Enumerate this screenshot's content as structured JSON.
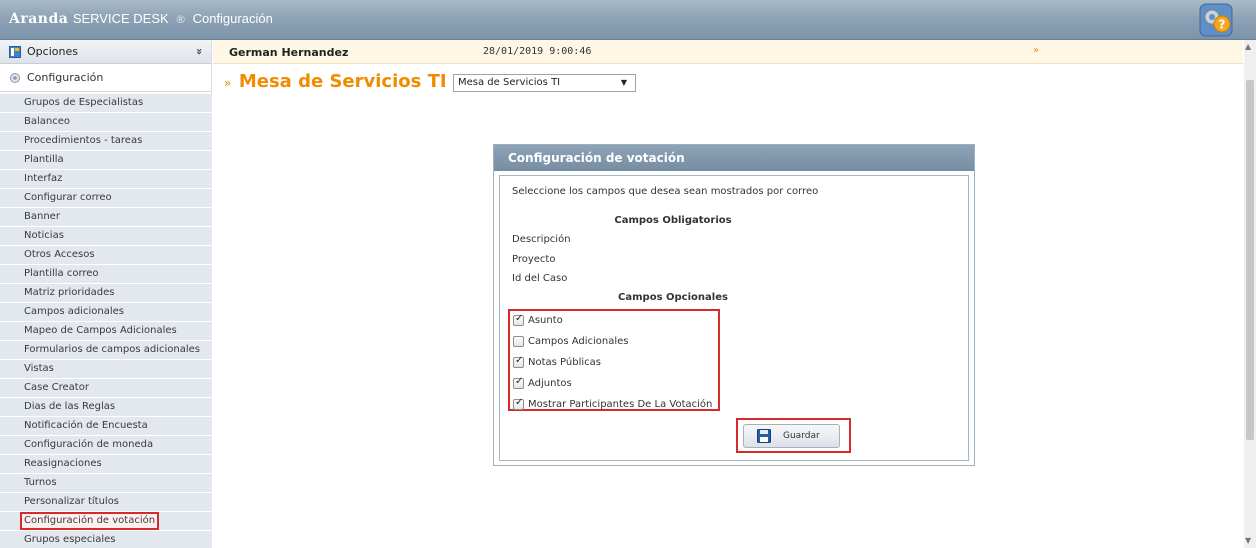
{
  "header": {
    "brand_bold": "Aranda",
    "brand_product": "SERVICE DESK",
    "brand_reg": "®",
    "brand_section": "Configuración",
    "help_icon": "help-gear-icon"
  },
  "sidebar": {
    "options_label": "Opciones",
    "options_chevron": "»",
    "section_label": "Configuración",
    "items": [
      {
        "label": "Grupos de Especialistas"
      },
      {
        "label": "Balanceo"
      },
      {
        "label": "Procedimientos - tareas"
      },
      {
        "label": "Plantilla"
      },
      {
        "label": "Interfaz"
      },
      {
        "label": "Configurar correo"
      },
      {
        "label": "Banner"
      },
      {
        "label": "Noticias"
      },
      {
        "label": "Otros Accesos"
      },
      {
        "label": "Plantilla correo"
      },
      {
        "label": "Matriz prioridades"
      },
      {
        "label": "Campos adicionales"
      },
      {
        "label": "Mapeo de Campos Adicionales"
      },
      {
        "label": "Formularios de campos adicionales"
      },
      {
        "label": "Vistas"
      },
      {
        "label": "Case Creator"
      },
      {
        "label": "Dias de las Reglas"
      },
      {
        "label": "Notificación de Encuesta"
      },
      {
        "label": "Configuración de moneda"
      },
      {
        "label": "Reasignaciones"
      },
      {
        "label": "Turnos"
      },
      {
        "label": "Personalizar títulos"
      },
      {
        "label": "Configuración de votación"
      },
      {
        "label": "Grupos especiales"
      }
    ]
  },
  "infobar": {
    "user": "German Hernandez",
    "datetime": "28/01/2019 9:00:46",
    "arrow": "»"
  },
  "main": {
    "title_arrow": "»",
    "title": "Mesa de Servicios TI",
    "select_value": "Mesa de Servicios TI"
  },
  "panel": {
    "title": "Configuración de votación",
    "intro": "Seleccione los campos que desea sean mostrados por correo",
    "required_heading": "Campos Obligatorios",
    "required_fields": [
      "Descripción",
      "Proyecto",
      "Id del Caso"
    ],
    "optional_heading": "Campos Opcionales",
    "optional_fields": [
      {
        "label": "Asunto",
        "checked": true
      },
      {
        "label": "Campos Adicionales",
        "checked": false
      },
      {
        "label": "Notas Públicas",
        "checked": true
      },
      {
        "label": "Adjuntos",
        "checked": true
      },
      {
        "label": "Mostrar Participantes De La Votación",
        "checked": true
      }
    ],
    "save_label": "Guardar",
    "save_icon": "floppy-disk-icon"
  },
  "colors": {
    "accent_orange": "#f08c00",
    "highlight_red": "#d62b2b",
    "header_blue": "#8ea3b6"
  }
}
